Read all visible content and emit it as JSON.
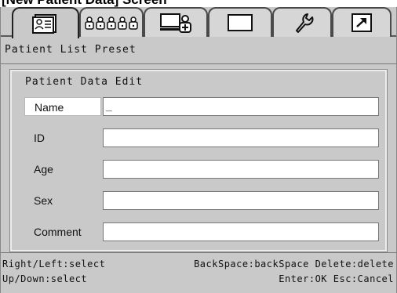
{
  "caption": "[New Patient Data] Screen",
  "tabs": [
    {
      "icon": "patient-list-icon",
      "active": true
    },
    {
      "icon": "series-icon",
      "active": false
    },
    {
      "icon": "computer-add-icon",
      "active": false
    },
    {
      "icon": "blank-frame-icon",
      "active": false
    },
    {
      "icon": "wrench-icon",
      "active": false
    },
    {
      "icon": "export-arrow-icon",
      "active": false
    }
  ],
  "header": {
    "title": "Patient List Preset"
  },
  "panel": {
    "title": "Patient Data Edit",
    "fields": [
      {
        "label": "Name",
        "value": "_",
        "selected": true
      },
      {
        "label": "ID",
        "value": "",
        "selected": false
      },
      {
        "label": "Age",
        "value": "",
        "selected": false
      },
      {
        "label": "Sex",
        "value": "",
        "selected": false
      },
      {
        "label": "Comment",
        "value": "",
        "selected": false
      }
    ]
  },
  "help": {
    "line1_left": "Right/Left:select",
    "line1_right": "BackSpace:backSpace Delete:delete",
    "line2_left": "Up/Down:select",
    "line2_right": "Enter:OK Esc:Cancel"
  }
}
